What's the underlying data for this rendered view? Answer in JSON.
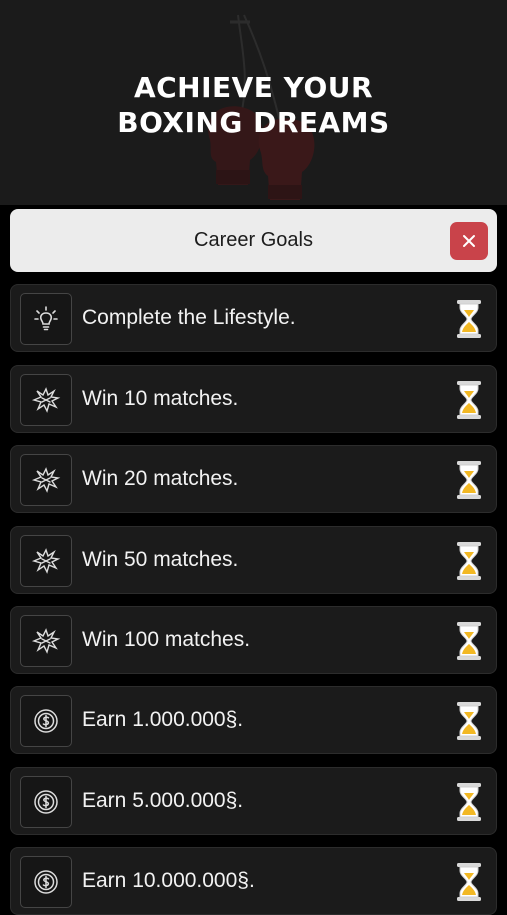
{
  "hero": {
    "title_line1": "ACHIEVE YOUR",
    "title_line2": "BOXING DREAMS",
    "art_icon": "hanging-boxing-gloves-icon"
  },
  "header": {
    "title": "Career Goals",
    "close_icon": "close-icon"
  },
  "goals": [
    {
      "label": "Complete the Lifestyle.",
      "icon": "lightbulb-icon",
      "status_icon": "hourglass-icon"
    },
    {
      "label": "Win 10 matches.",
      "icon": "punch-impact-icon",
      "status_icon": "hourglass-icon"
    },
    {
      "label": "Win 20 matches.",
      "icon": "punch-impact-icon",
      "status_icon": "hourglass-icon"
    },
    {
      "label": "Win 50 matches.",
      "icon": "punch-impact-icon",
      "status_icon": "hourglass-icon"
    },
    {
      "label": "Win 100 matches.",
      "icon": "punch-impact-icon",
      "status_icon": "hourglass-icon"
    },
    {
      "label": "Earn 1.000.000§.",
      "icon": "coin-icon",
      "status_icon": "hourglass-icon"
    },
    {
      "label": "Earn 5.000.000§.",
      "icon": "coin-icon",
      "status_icon": "hourglass-icon"
    },
    {
      "label": "Earn 10.000.000§.",
      "icon": "coin-icon",
      "status_icon": "hourglass-icon"
    }
  ],
  "colors": {
    "background": "#000000",
    "hero_bg": "#1b1b1b",
    "row_bg": "#1b1b1b",
    "header_bg": "#ececec",
    "close_button": "#c9434a",
    "hourglass_sand": "#f2b824"
  }
}
